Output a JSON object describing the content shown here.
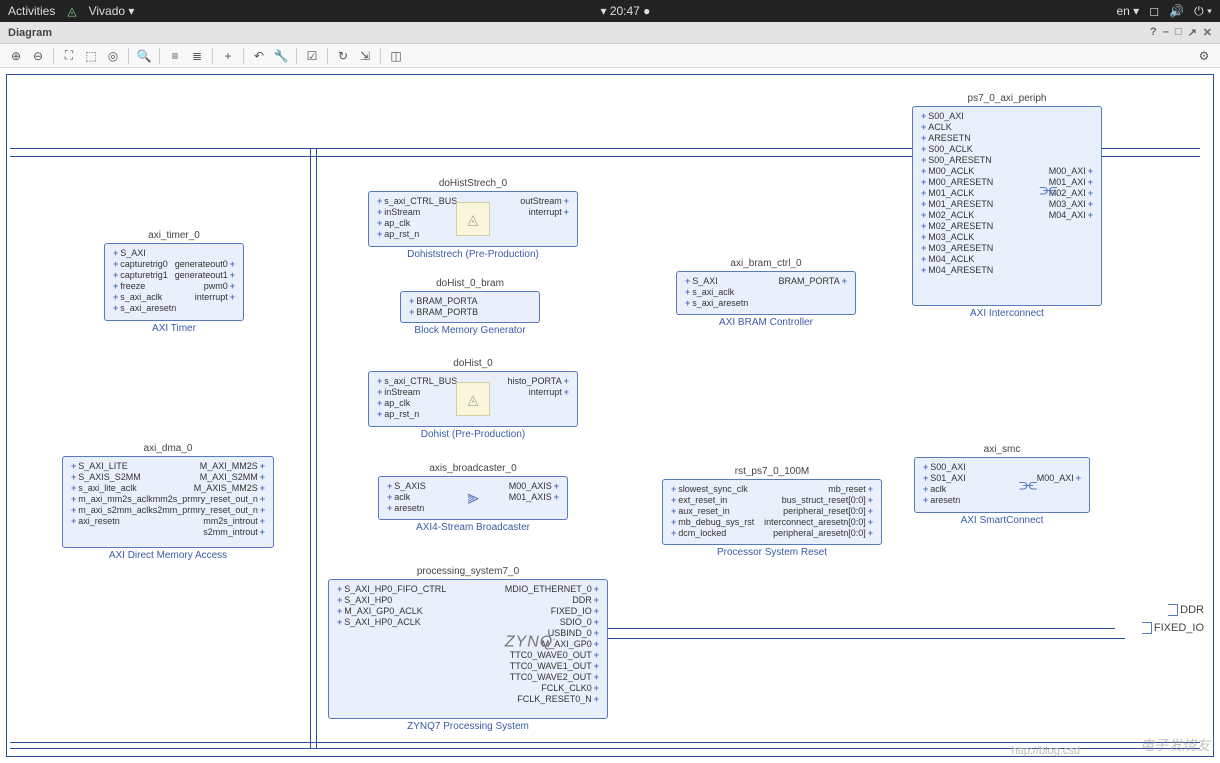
{
  "topbar": {
    "activities": "Activities",
    "app_name": "Vivado ▾",
    "clock": "20:47",
    "lang": "en ▾"
  },
  "panel": {
    "title": "Diagram"
  },
  "toolbar": {
    "zoom_in": "⊕",
    "zoom_out": "⊖",
    "fit": "⛶",
    "sel": "⬚",
    "target": "◎",
    "search": "🔍",
    "hsplit": "≡",
    "vsplit": "≣",
    "add": "+",
    "undo": "↶",
    "wrench": "🔧",
    "check": "☑",
    "refresh": "↻",
    "export": "⇲",
    "ip": "◫",
    "gear": "⚙"
  },
  "blocks": {
    "axi_timer": {
      "name": "axi_timer_0",
      "type": "AXI Timer",
      "left": [
        "S_AXI",
        "capturetrig0",
        "capturetrig1",
        "freeze",
        "s_axi_aclk",
        "s_axi_aresetn"
      ],
      "right": [
        "",
        "generateout0",
        "generateout1",
        "pwm0",
        "interrupt",
        ""
      ]
    },
    "axi_dma": {
      "name": "axi_dma_0",
      "type": "AXI Direct Memory Access",
      "left": [
        "S_AXI_LITE",
        "S_AXIS_S2MM",
        "s_axi_lite_aclk",
        "m_axi_mm2s_aclk",
        "m_axi_s2mm_aclk",
        "axi_resetn"
      ],
      "right": [
        "M_AXI_MM2S",
        "M_AXI_S2MM",
        "M_AXIS_MM2S",
        "mm2s_prmry_reset_out_n",
        "s2mm_prmry_reset_out_n",
        "mm2s_introut",
        "s2mm_introut"
      ]
    },
    "hist_stretch": {
      "name": "doHistStrech_0",
      "type": "Dohiststrech (Pre-Production)",
      "left": [
        "s_axi_CTRL_BUS",
        "inStream",
        "ap_clk",
        "ap_rst_n"
      ],
      "right": [
        "outStream",
        "interrupt",
        "",
        ""
      ]
    },
    "hist_bram": {
      "name": "doHist_0_bram",
      "type": "Block Memory Generator",
      "left": [
        "BRAM_PORTA",
        "BRAM_PORTB"
      ]
    },
    "hist": {
      "name": "doHist_0",
      "type": "Dohist (Pre-Production)",
      "left": [
        "s_axi_CTRL_BUS",
        "inStream",
        "ap_clk",
        "ap_rst_n"
      ],
      "right": [
        "histo_PORTA",
        "interrupt",
        "",
        ""
      ]
    },
    "broadcaster": {
      "name": "axis_broadcaster_0",
      "type": "AXI4-Stream Broadcaster",
      "left": [
        "S_AXIS",
        "aclk",
        "aresetn"
      ],
      "right": [
        "M00_AXIS",
        "M01_AXIS",
        ""
      ]
    },
    "ps7": {
      "name": "processing_system7_0",
      "type": "ZYNQ7 Processing System",
      "left": [
        "S_AXI_HP0_FIFO_CTRL",
        "S_AXI_HP0",
        "M_AXI_GP0_ACLK",
        "S_AXI_HP0_ACLK"
      ],
      "right": [
        "MDIO_ETHERNET_0",
        "DDR",
        "FIXED_IO",
        "SDIO_0",
        "USBIND_0",
        "M_AXI_GP0",
        "TTC0_WAVE0_OUT",
        "TTC0_WAVE1_OUT",
        "TTC0_WAVE2_OUT",
        "FCLK_CLK0",
        "FCLK_RESET0_N"
      ]
    },
    "bram_ctrl": {
      "name": "axi_bram_ctrl_0",
      "type": "AXI BRAM Controller",
      "left": [
        "S_AXI",
        "s_axi_aclk",
        "s_axi_aresetn"
      ],
      "right": [
        "BRAM_PORTA",
        "",
        ""
      ]
    },
    "rst": {
      "name": "rst_ps7_0_100M",
      "type": "Processor System Reset",
      "left": [
        "slowest_sync_clk",
        "ext_reset_in",
        "aux_reset_in",
        "mb_debug_sys_rst",
        "dcm_locked"
      ],
      "right": [
        "mb_reset",
        "bus_struct_reset[0:0]",
        "peripheral_reset[0:0]",
        "interconnect_aresetn[0:0]",
        "peripheral_aresetn[0:0]"
      ]
    },
    "axi_periph": {
      "name": "ps7_0_axi_periph",
      "type": "AXI Interconnect",
      "left": [
        "S00_AXI",
        "ACLK",
        "ARESETN",
        "S00_ACLK",
        "S00_ARESETN",
        "M00_ACLK",
        "M00_ARESETN",
        "M01_ACLK",
        "M01_ARESETN",
        "M02_ACLK",
        "M02_ARESETN",
        "M03_ACLK",
        "M03_ARESETN",
        "M04_ACLK",
        "M04_ARESETN"
      ],
      "right": [
        "",
        "",
        "",
        "",
        "",
        "M00_AXI",
        "M01_AXI",
        "M02_AXI",
        "M03_AXI",
        "M04_AXI",
        "",
        "",
        "",
        "",
        ""
      ]
    },
    "smc": {
      "name": "axi_smc",
      "type": "AXI SmartConnect",
      "left": [
        "S00_AXI",
        "S01_AXI",
        "aclk",
        "aresetn"
      ],
      "right": [
        "",
        "M00_AXI",
        "",
        ""
      ]
    }
  },
  "ports": {
    "ddr": "DDR",
    "fixed_io": "FIXED_IO"
  },
  "watermark": "电子发烧友",
  "watermark_url": "http://blog.csd"
}
